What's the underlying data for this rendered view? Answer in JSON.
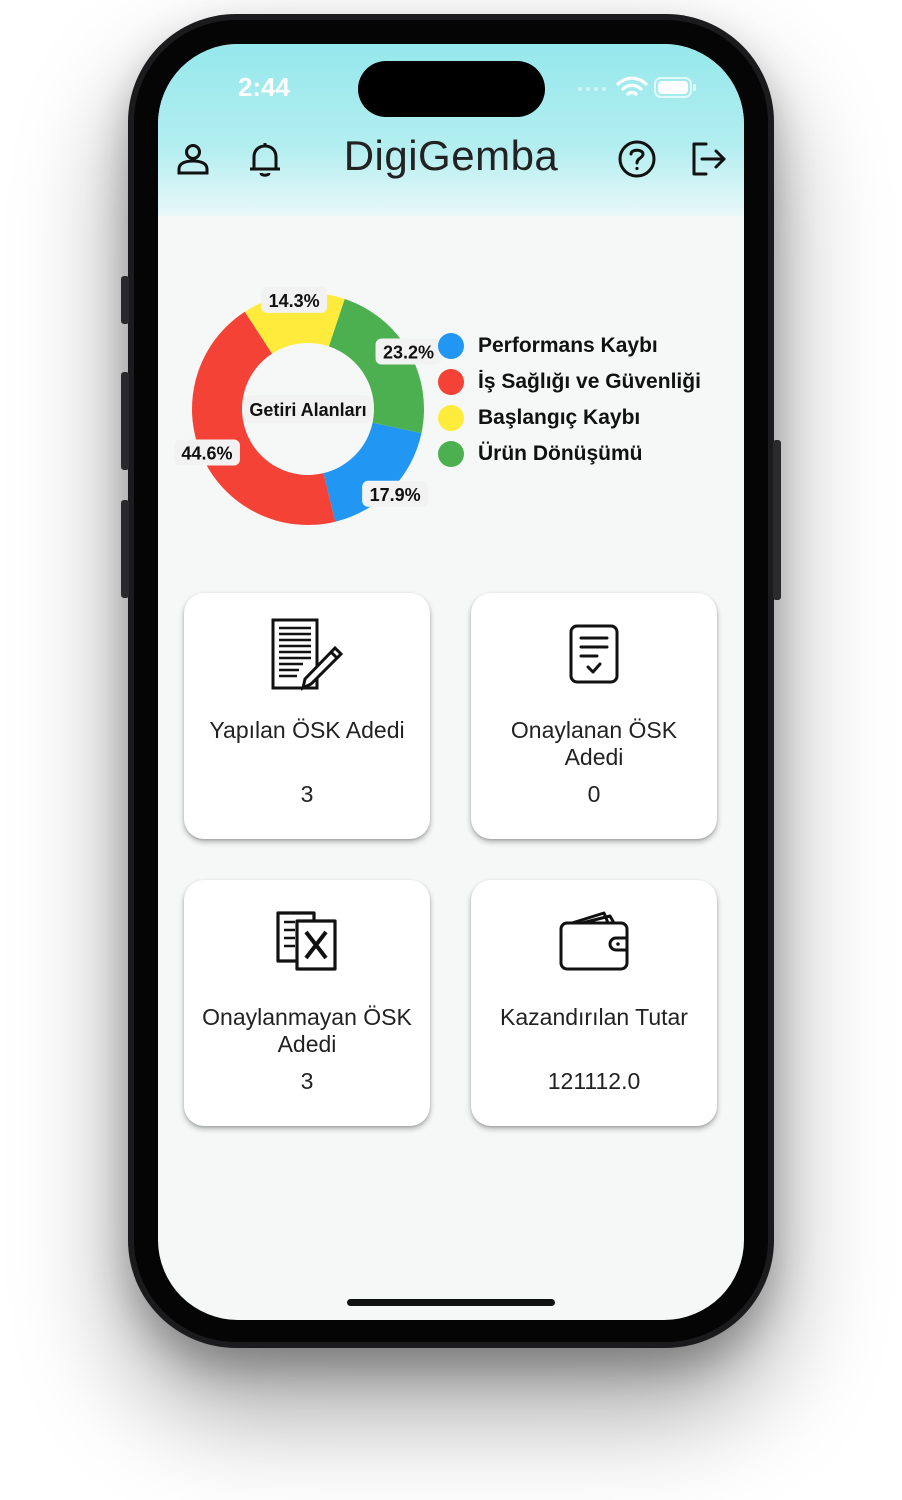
{
  "status_bar": {
    "time": "2:44"
  },
  "header": {
    "title": "DigiGemba"
  },
  "chart_data": {
    "type": "pie",
    "center_label": "Getiri Alanları",
    "slices": [
      {
        "name": "Performans Kaybı",
        "value": 17.9,
        "label": "17.9%",
        "color": "#2196F3"
      },
      {
        "name": "İş Sağlığı ve Güvenliği",
        "value": 44.6,
        "label": "44.6%",
        "color": "#F44336"
      },
      {
        "name": "Başlangıç Kaybı",
        "value": 14.3,
        "label": "14.3%",
        "color": "#FFEB3B"
      },
      {
        "name": "Ürün Dönüşümü",
        "value": 23.2,
        "label": "23.2%",
        "color": "#4CAF50"
      }
    ],
    "legend_position": "right"
  },
  "legend": [
    {
      "label": "Performans Kaybı",
      "color": "#2196F3"
    },
    {
      "label": "İş Sağlığı ve Güvenliği",
      "color": "#F44336"
    },
    {
      "label": "Başlangıç Kaybı",
      "color": "#FFEB3B"
    },
    {
      "label": "Ürün Dönüşümü",
      "color": "#4CAF50"
    }
  ],
  "cards": [
    {
      "label": "Yapılan ÖSK Adedi",
      "value": "3",
      "icon": "document-edit-icon"
    },
    {
      "label": "Onaylanan ÖSK Adedi",
      "value": "0",
      "icon": "approved-document-icon"
    },
    {
      "label": "Onaylanmayan ÖSK Adedi",
      "value": "3",
      "icon": "rejected-document-icon"
    },
    {
      "label": "Kazandırılan Tutar",
      "value": "121112.0",
      "icon": "wallet-icon"
    }
  ]
}
